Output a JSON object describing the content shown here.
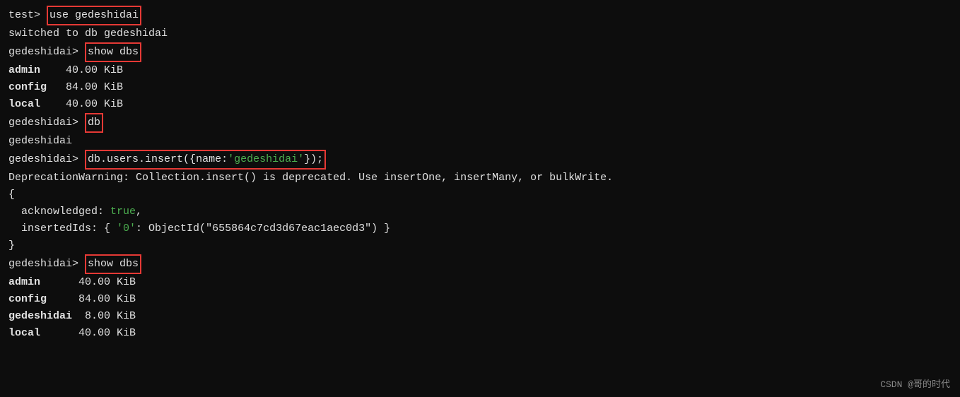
{
  "terminal": {
    "lines": [
      {
        "type": "prompt-cmd",
        "prompt": "test> ",
        "cmd": "use gedeshidai",
        "boxed": true
      },
      {
        "type": "output",
        "text": "switched to db gedeshidai"
      },
      {
        "type": "prompt-cmd",
        "prompt": "gedeshidai> ",
        "cmd": "show dbs",
        "boxed": true
      },
      {
        "type": "db-entry",
        "name": "admin",
        "size": "40.00 KiB"
      },
      {
        "type": "db-entry",
        "name": "config",
        "size": "84.00 KiB"
      },
      {
        "type": "db-entry",
        "name": "local",
        "size": "40.00 KiB"
      },
      {
        "type": "prompt-cmd",
        "prompt": "gedeshidai> ",
        "cmd": "db",
        "boxed": true
      },
      {
        "type": "output",
        "text": "gedeshidai"
      },
      {
        "type": "prompt-cmd-colored",
        "prompt": "gedeshidai> ",
        "cmd_pre": "db.users.insert({",
        "cmd_key": "name",
        "cmd_sep": ":",
        "cmd_val": "'gedeshidai'",
        "cmd_post": "});",
        "boxed": true
      },
      {
        "type": "output",
        "text": "DeprecationWarning: Collection.insert() is deprecated. Use insertOne, insertMany, or bulkWrite."
      },
      {
        "type": "output",
        "text": "{"
      },
      {
        "type": "output-indent",
        "text": "  acknowledged: ",
        "value": "true",
        "suffix": ","
      },
      {
        "type": "output-indent2",
        "text": "  insertedIds: { ",
        "value": "'0'",
        "suffix": ": ObjectId(\"655864c7cd3d67eac1aec0d3\") }"
      },
      {
        "type": "output",
        "text": "}"
      },
      {
        "type": "prompt-cmd",
        "prompt": "gedeshidai> ",
        "cmd": "show dbs",
        "boxed": true
      },
      {
        "type": "db-entry",
        "name": "admin",
        "size": "40.00 KiB"
      },
      {
        "type": "db-entry",
        "name": "config",
        "size": "84.00 KiB"
      },
      {
        "type": "db-entry-bold",
        "name": "gedeshidai",
        "size": " 8.00 KiB"
      },
      {
        "type": "db-entry",
        "name": "local",
        "size": "40.00 KiB"
      }
    ],
    "watermark": "CSDN @哥的时代"
  }
}
